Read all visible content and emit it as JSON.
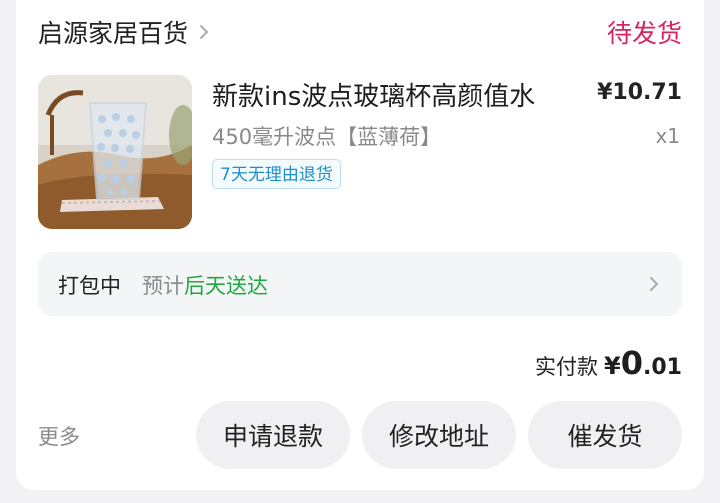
{
  "shop": {
    "name": "启源家居百货",
    "status": "待发货"
  },
  "product": {
    "title": "新款ins波点玻璃杯高颜值水",
    "price": "¥10.71",
    "sku": "450毫升波点【蓝薄荷】",
    "qty": "x1",
    "tag": "7天无理由退货"
  },
  "shipping": {
    "label": "打包中",
    "prefix": "预计",
    "eta": "后天送达"
  },
  "payment": {
    "label": "实付款",
    "currency": "¥",
    "integer": "0",
    "decimal": ".01"
  },
  "actions": {
    "more": "更多",
    "refund": "申请退款",
    "address": "修改地址",
    "urge": "催发货"
  },
  "colors": {
    "status": "#d6245e",
    "eta": "#22a83e",
    "tag": "#1f8ec9"
  }
}
